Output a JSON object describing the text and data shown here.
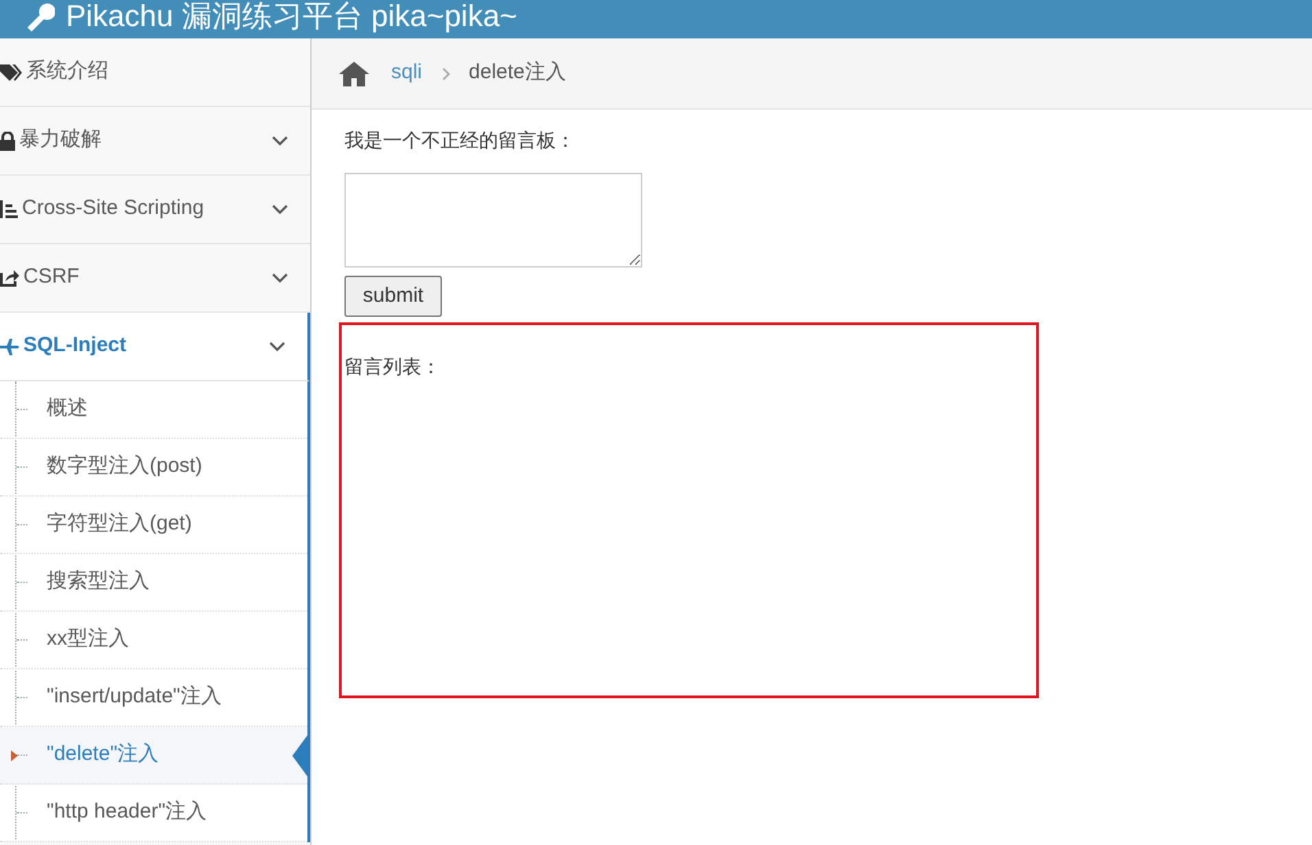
{
  "header": {
    "title": "Pikachu 漏洞练习平台 pika~pika~"
  },
  "sidebar": {
    "items": [
      {
        "label": "系统介绍",
        "expandable": false,
        "expanded": false
      },
      {
        "label": "暴力破解",
        "expandable": true,
        "expanded": false
      },
      {
        "label": "Cross-Site Scripting",
        "expandable": true,
        "expanded": false
      },
      {
        "label": "CSRF",
        "expandable": true,
        "expanded": false
      },
      {
        "label": "SQL-Inject",
        "expandable": true,
        "expanded": true,
        "children": [
          {
            "label": "概述",
            "selected": false
          },
          {
            "label": "数字型注入(post)",
            "selected": false
          },
          {
            "label": "字符型注入(get)",
            "selected": false
          },
          {
            "label": "搜索型注入",
            "selected": false
          },
          {
            "label": "xx型注入",
            "selected": false
          },
          {
            "label": "\"insert/update\"注入",
            "selected": false
          },
          {
            "label": "\"delete\"注入",
            "selected": true
          },
          {
            "label": "\"http header\"注入",
            "selected": false
          }
        ]
      }
    ]
  },
  "breadcrumb": [
    {
      "label": "sqli",
      "link": true
    },
    {
      "label": "delete注入",
      "link": false
    }
  ],
  "form": {
    "prompt": "我是一个不正经的留言板：",
    "submit": "submit"
  },
  "list_title": "留言列表："
}
